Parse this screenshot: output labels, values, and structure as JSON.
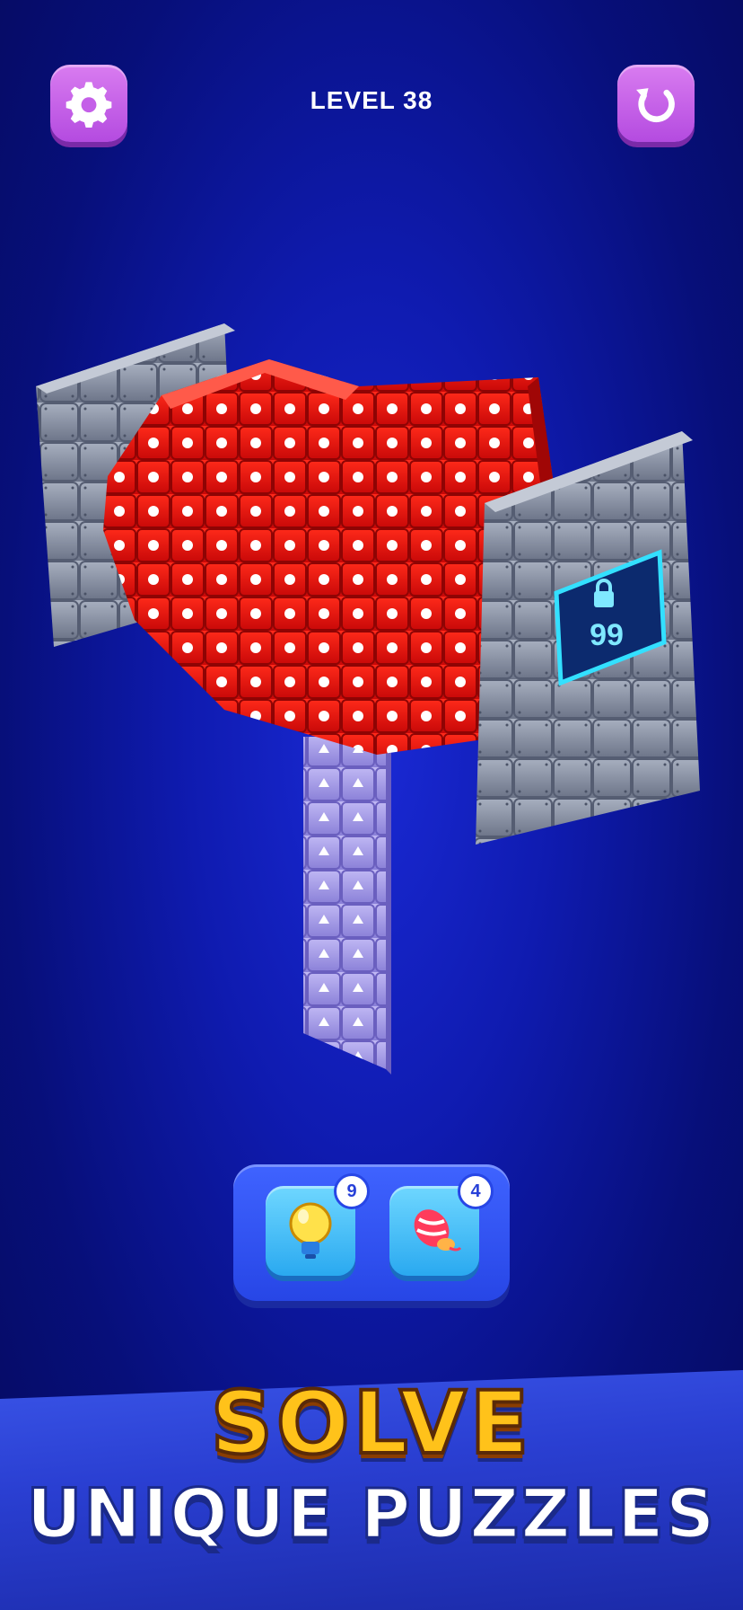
{
  "header": {
    "level_label": "LEVEL 38",
    "settings_icon": "gear-icon",
    "restart_icon": "restart-icon"
  },
  "board": {
    "locked_panel": {
      "icon": "lock-icon",
      "count": "99"
    }
  },
  "powerups": {
    "hint": {
      "icon": "lightbulb-icon",
      "count": "9"
    },
    "bomb": {
      "icon": "firework-icon",
      "count": "4"
    }
  },
  "banner": {
    "line1": "SOLVE",
    "line2": "UNIQUE PUZZLES"
  },
  "colors": {
    "background": "#0f1bb0",
    "button_purple": "#c45fe8",
    "block_red": "#e01010",
    "block_gray": "#8a94a8",
    "block_lavender": "#a8a0e8",
    "banner_yellow": "#ffc21a"
  }
}
